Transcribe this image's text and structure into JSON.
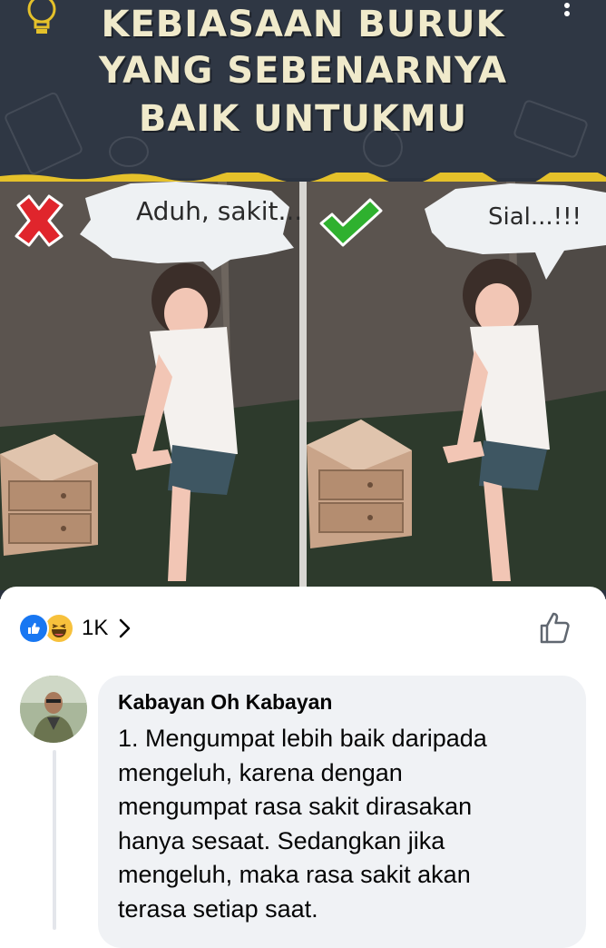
{
  "post_image": {
    "title_line1": "KEBIASAAN BURUK",
    "title_line2": "YANG SEBENARNYA",
    "title_line3": "BAIK UNTUKMU",
    "left_panel": {
      "status": "wrong",
      "speech": "Aduh, sakit..."
    },
    "right_panel": {
      "status": "right",
      "speech": "Sial...!!!"
    }
  },
  "reactions": {
    "icons": [
      "like-icon",
      "haha-icon"
    ],
    "count": "1K",
    "like_color": "#1877f2"
  },
  "comment": {
    "author": "Kabayan Oh Kabayan",
    "lines": [
      "1. Mengumpat lebih baik daripada",
      "mengeluh, karena dengan",
      "mengumpat rasa sakit dirasakan",
      "hanya sesaat. Sedangkan jika",
      "mengeluh, maka rasa sakit akan",
      "terasa setiap saat."
    ]
  },
  "colors": {
    "header_bg": "#2f3744",
    "title": "#f0eacb",
    "accent_yellow": "#e5c12a",
    "wrong_red": "#e0252c",
    "right_green": "#2fb12f",
    "comment_bg": "#f0f2f5"
  }
}
